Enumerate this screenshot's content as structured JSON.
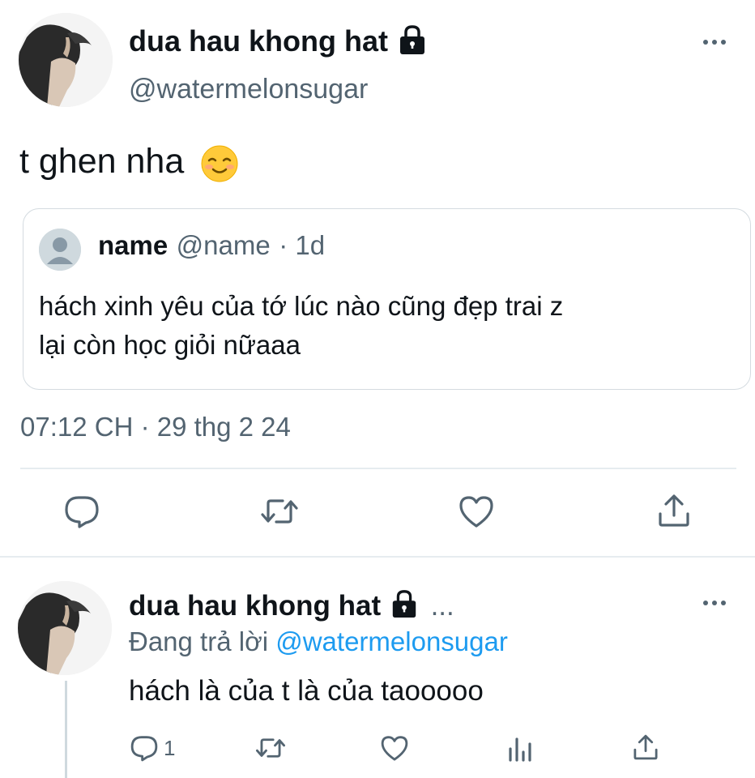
{
  "main_tweet": {
    "author_name": "dua hau khong hat",
    "handle": "@watermelonsugar",
    "text": "t ghen nha",
    "emoji": "☺️",
    "timestamp": "07:12 CH · 29 thg 2 24"
  },
  "quote": {
    "name": "name",
    "handle": "@name",
    "time": "· 1d",
    "text_line1": "hách xinh yêu của tớ lúc nào cũng đẹp trai z",
    "text_line2": "lại còn học giỏi nữaaa"
  },
  "reply": {
    "author_name": "dua hau khong hat",
    "ellipsis": "...",
    "reply_prefix": "Đang trả lời",
    "reply_handle": "@watermelonsugar",
    "text": "hách là của t là của taooooo",
    "reply_count": "1"
  },
  "icons": {
    "lock": "lock-icon",
    "more": "more-icon",
    "reply": "reply-icon",
    "retweet": "retweet-icon",
    "like": "heart-icon",
    "share": "share-icon",
    "analytics": "analytics-icon"
  },
  "colors": {
    "text": "#0f1419",
    "secondary": "#536471",
    "link": "#1d9bf0",
    "border": "#d4dbe0"
  }
}
